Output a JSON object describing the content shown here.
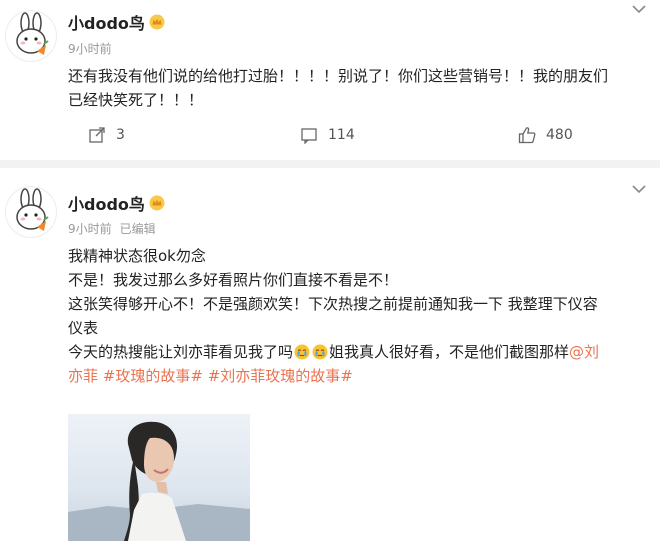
{
  "posts": [
    {
      "username": "小dodo鸟",
      "time": "9小时前",
      "edited": "",
      "text_lines": [
        "还有我没有他们说的给他打过胎！！！！别说了！你们这些营销号！！我的朋友们",
        "已经快笑死了！！！"
      ],
      "repost_count": "3",
      "comment_count": "114",
      "like_count": "480"
    },
    {
      "username": "小dodo鸟",
      "time": "9小时前",
      "edited": "已编辑",
      "line1": "我精神状态很ok勿念",
      "line2": "不是！我发过那么多好看照片你们直接不看是不！",
      "line3": "这张笑得够开心不！不是强颜欢笑！下次热搜之前提前通知我一下 我整理下仪容",
      "line4": "仪表",
      "line5_a": "今天的热搜能让刘亦菲看见我了吗",
      "line5_b": "姐我真人很好看，不是他们截图那样",
      "line5_mention": "@刘",
      "line6_mention": "亦菲",
      "hashtag1": "#玫瑰的故事#",
      "hashtag2": "#刘亦菲玫瑰的故事#"
    }
  ],
  "icons": {
    "avatar": "white-rabbit-avatar-icon",
    "crown": "crown-badge-icon",
    "menu": "chevron-down-icon",
    "repost": "repost-icon",
    "comment": "comment-icon",
    "like": "thumbs-up-icon",
    "emoji": "crying-emoji-icon"
  },
  "colors": {
    "link": "#eb7350",
    "meta": "#999999",
    "separator": "#f2f2f2"
  }
}
